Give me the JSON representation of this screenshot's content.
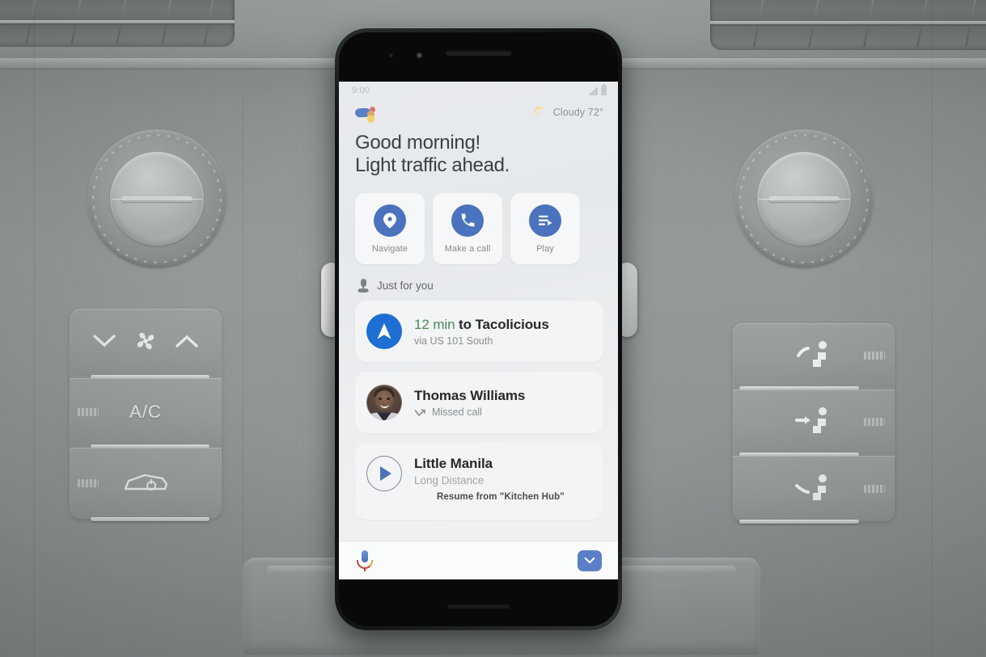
{
  "scene": {
    "description": "Phone mounted on car dashboard showing Google Assistant driving mode",
    "car_controls": {
      "fan_down_icon": "chevron-down-icon",
      "fan_icon": "fan-icon",
      "fan_up_icon": "chevron-up-icon",
      "ac_label": "A/C",
      "recirculate_icon": "air-recirculation-icon",
      "seat_icons": [
        "seat-heater-icon",
        "seat-vent-icon",
        "seat-heater-icon"
      ]
    }
  },
  "phone": {
    "status_bar": {
      "time": "9:00",
      "signal_icon": "signal-bars-icon",
      "battery_icon": "battery-icon"
    },
    "header": {
      "assistant_logo": "google-assistant-logo",
      "weather_icon": "partly-cloudy-icon",
      "weather_text": "Cloudy 72°"
    },
    "greeting": {
      "line1": "Good morning!",
      "line2": "Light traffic ahead."
    },
    "actions": [
      {
        "label": "Navigate",
        "icon": "location-pin-icon"
      },
      {
        "label": "Make a call",
        "icon": "phone-handset-icon"
      },
      {
        "label": "Play",
        "icon": "media-play-list-icon"
      }
    ],
    "section": {
      "icon": "person-mic-icon",
      "label": "Just for you"
    },
    "feed": [
      {
        "type": "navigation",
        "icon": "navigation-arrow-icon",
        "eta": "12 min",
        "title_rest": " to Tacolicious",
        "subtitle": "via US 101 South"
      },
      {
        "type": "missed-call",
        "icon": "contact-avatar",
        "title": "Thomas Williams",
        "status_icon": "missed-call-arrow-icon",
        "subtitle": "Missed call"
      },
      {
        "type": "media",
        "icon": "play-circle-icon",
        "title": "Little Manila",
        "subtitle": "Long Distance",
        "resume": "Resume from \"Kitchen Hub\""
      }
    ],
    "bottom_bar": {
      "mic_icon": "google-mic-icon",
      "collapse_icon": "chevron-down-icon"
    }
  },
  "colors": {
    "accent_blue": "#4b72bd",
    "nav_blue": "#1d6fd4",
    "eta_green": "#4a8a5a",
    "text_primary": "#3c4043",
    "text_secondary": "#8a8f93",
    "screen_bg": "#e9ecee",
    "card_bg": "#f2f4f5"
  }
}
